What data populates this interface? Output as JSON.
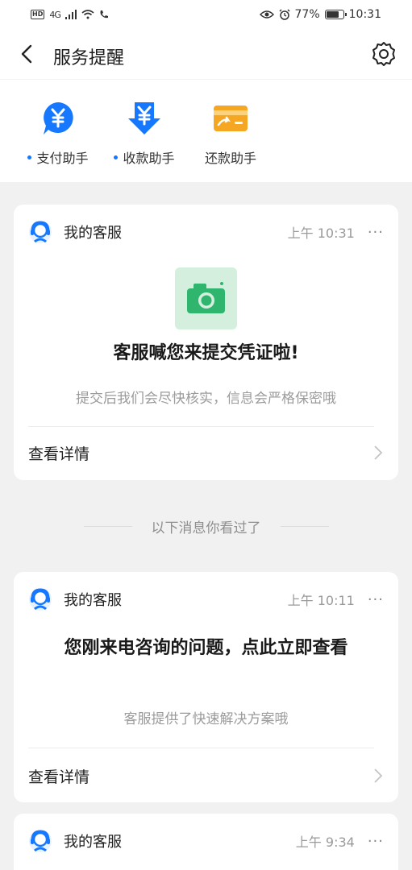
{
  "status_bar": {
    "hd": "HD",
    "network": "4G",
    "battery": "77%",
    "time": "10:31"
  },
  "header": {
    "title": "服务提醒"
  },
  "helpers": [
    {
      "label": "支付助手",
      "unread": true,
      "icon": "payment-yuan-icon"
    },
    {
      "label": "收款助手",
      "unread": true,
      "icon": "receive-yuan-icon"
    },
    {
      "label": "还款助手",
      "unread": false,
      "icon": "repay-card-icon"
    }
  ],
  "cards": [
    {
      "sender": "我的客服",
      "time": "上午 10:31",
      "more": "···",
      "title": "客服喊您来提交凭证啦!",
      "subtitle": "提交后我们会尽快核实，信息会严格保密哦",
      "detail": "查看详情"
    },
    {
      "sender": "我的客服",
      "time": "上午 10:11",
      "more": "···",
      "title": "您刚来电咨询的问题，点此立即查看",
      "subtitle": "客服提供了快速解决方案哦",
      "detail": "查看详情"
    },
    {
      "sender": "我的客服",
      "time": "上午 9:34",
      "more": "···"
    }
  ],
  "seen_divider": "以下消息你看过了",
  "colors": {
    "accent": "#1677ff",
    "camera_green": "#2fb56d",
    "card_orange": "#f5a623"
  }
}
